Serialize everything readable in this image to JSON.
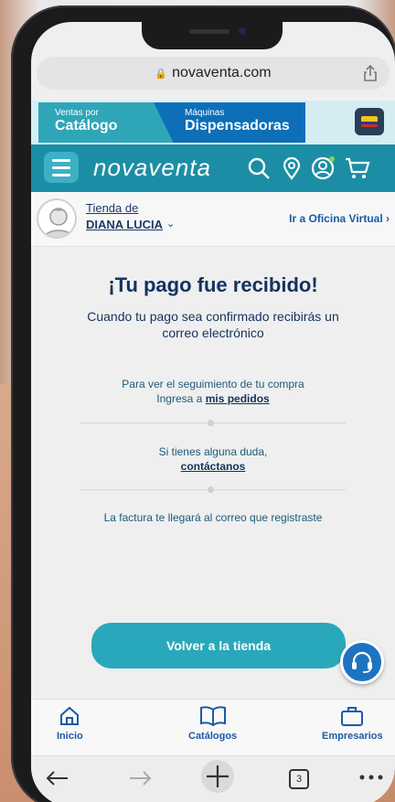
{
  "browser": {
    "url": "novaventa.com",
    "tab_count": "3"
  },
  "top_tabs": {
    "catalogo_small": "Ventas por",
    "catalogo_big": "Catálogo",
    "maquinas_small": "Máquinas",
    "maquinas_big": "Dispensadoras"
  },
  "header": {
    "logo": "novaventa",
    "accent_color": "#1b8ea5"
  },
  "store": {
    "label": "Tienda de",
    "name": "DIANA LUCIA",
    "oficina_link": "Ir a Oficina Virtual"
  },
  "main": {
    "title": "¡Tu pago fue recibido!",
    "subtitle": "Cuando tu pago sea confirmado recibirás un correo electrónico",
    "tracking_text": "Para ver el seguimiento de tu compra",
    "tracking_prefix": "Ingresa a",
    "tracking_link": "mis pedidos",
    "doubt_text": "Si tienes alguna duda,",
    "doubt_link": "contáctanos",
    "invoice_text": "La factura te llegará al correo que registraste",
    "back_button": "Volver a la tienda"
  },
  "bottom_nav": {
    "items": [
      {
        "label": "Inicio",
        "icon": "home-icon"
      },
      {
        "label": "Catálogos",
        "icon": "book-icon"
      },
      {
        "label": "Empresarios",
        "icon": "briefcase-icon"
      }
    ]
  }
}
